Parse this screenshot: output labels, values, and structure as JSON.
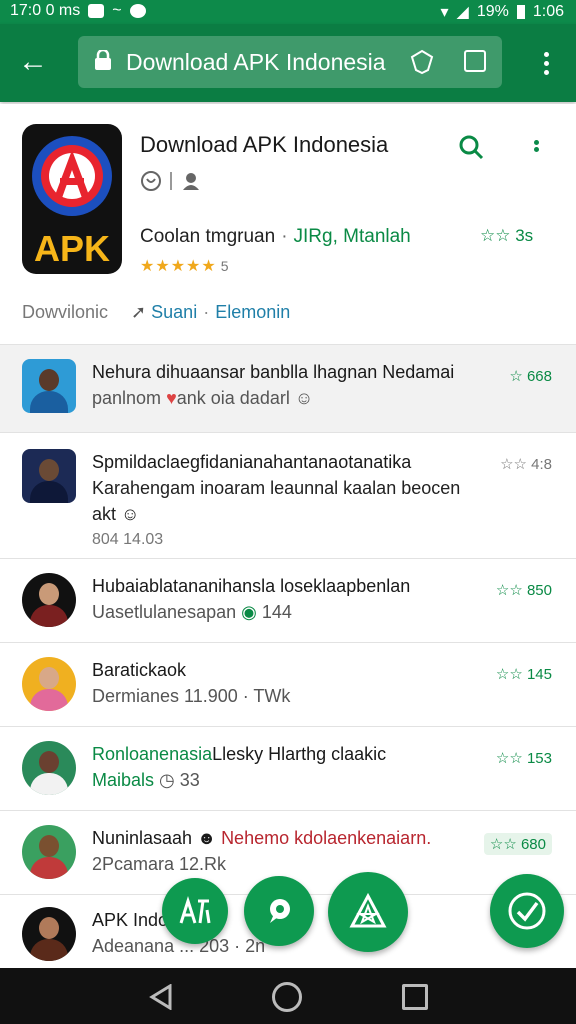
{
  "status_bar": {
    "time_left": "17:0 0 ms",
    "battery": "19%",
    "time": "1:06"
  },
  "address_bar": {
    "url": "Download APK Indonesia"
  },
  "app": {
    "name": "Download APK Indonesia",
    "logo_text": "APK",
    "meta_left": "Coolan tmgruan",
    "meta_sep": "·",
    "meta_dev": "JIRg, Mtanlah",
    "rating": "3s",
    "star_count": "5",
    "downloads_label": "Dowvilonic",
    "link_share": "Suani",
    "link_sep": "·",
    "link_other": "Elemonin"
  },
  "list": [
    {
      "line1": "Nehura dihuaansar banblla lhagnan Nedamai",
      "line2": "panlnom",
      "line2b": "ank oia dadarl",
      "rating": "668",
      "highlight": true
    },
    {
      "line1": "Spmildaclaegfidanianahantanaotanatika",
      "line2": "Karahengam inoaram leaunnal kaalan beocen akt",
      "line3": "804 14.03",
      "rating": "4:8"
    },
    {
      "line1": "Hubaiablatananihansla loseklaapbenlan",
      "line2": "Uasetlulanesapan",
      "line2b": "144",
      "rating": "850"
    },
    {
      "line1": "Baratickaok",
      "line2": "Dermianes 11.900 · TWk",
      "rating": "145"
    },
    {
      "line1": "Ronloanenasia",
      "line1b": "Llesky Hlarthg claakic",
      "line2": "Maibals",
      "line2b": "33",
      "rating": "153"
    },
    {
      "line1": "Nuninlasaah",
      "line1b": "Nehemo kdolaenkenaiarn.",
      "line2": "2Pcamara 12.Rk",
      "rating": "680"
    },
    {
      "line1": "APK Indo...",
      "line2": "Adeanana ...",
      "line2b": "203 · 2n",
      "rating": ""
    }
  ]
}
